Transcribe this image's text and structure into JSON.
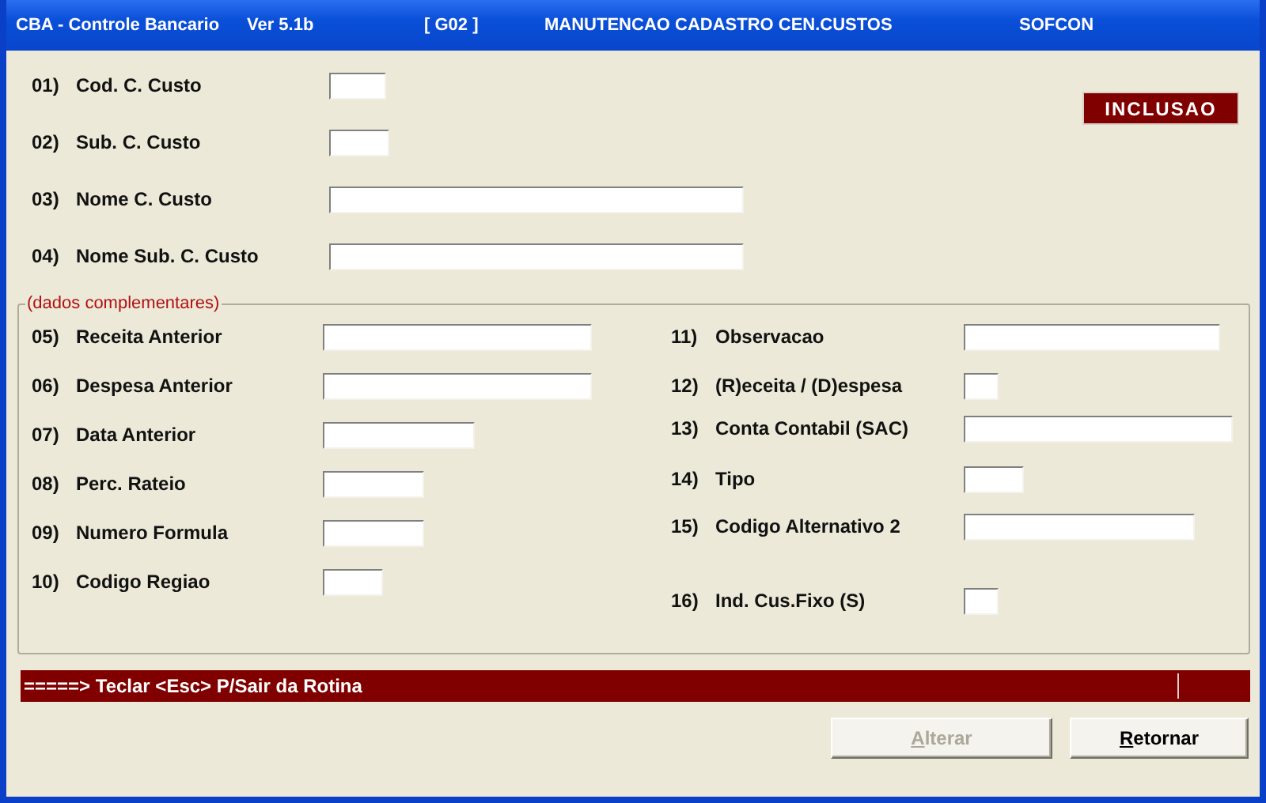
{
  "window": {
    "title_parts": [
      "CBA - Controle Bancario",
      "Ver 5.1b",
      "[ G02 ]",
      "MANUTENCAO CADASTRO CEN.CUSTOS",
      "SOFCON"
    ]
  },
  "mode_badge": "INCLUSAO",
  "fields": [
    {
      "number": "01)",
      "label": "Cod. C. Custo"
    },
    {
      "number": "02)",
      "label": "Sub. C. Custo"
    },
    {
      "number": "03)",
      "label": "Nome C. Custo"
    },
    {
      "number": "04)",
      "label": "Nome Sub. C. Custo"
    }
  ],
  "group": {
    "legend": "(dados complementares)",
    "left_fields": [
      {
        "number": "05)",
        "label": "Receita Anterior"
      },
      {
        "number": "06)",
        "label": "Despesa Anterior"
      },
      {
        "number": "07)",
        "label": "Data Anterior"
      },
      {
        "number": "08)",
        "label": "Perc. Rateio"
      },
      {
        "number": "09)",
        "label": "Numero Formula"
      },
      {
        "number": "10)",
        "label": "Codigo Regiao"
      }
    ],
    "right_fields": [
      {
        "number": "11)",
        "label": "Observacao"
      },
      {
        "number": "12)",
        "label": "(R)eceita / (D)espesa"
      },
      {
        "number": "13)",
        "label": "Conta Contabil (SAC)"
      },
      {
        "number": "14)",
        "label": "Tipo"
      },
      {
        "number": "15)",
        "label": "Codigo Alternativo 2"
      },
      {
        "number": "16)",
        "label": "Ind. Cus.Fixo (S)"
      }
    ]
  },
  "status_bar": "=====> Teclar <Esc> P/Sair da Rotina",
  "buttons": [
    {
      "label": "Alterar",
      "disabled": true
    },
    {
      "label": "Retornar",
      "disabled": false
    }
  ]
}
